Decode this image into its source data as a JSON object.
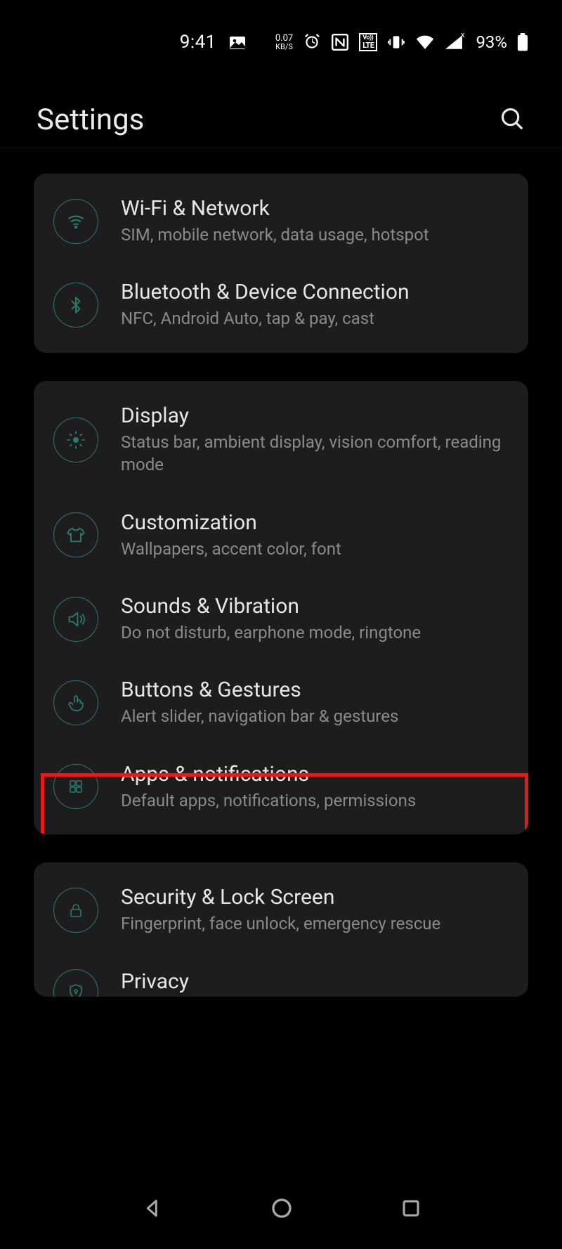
{
  "status": {
    "time": "9:41",
    "data_rate_value": "0.07",
    "data_rate_unit": "KB/S",
    "volte": "VoLTE",
    "battery_pct": "93%"
  },
  "header": {
    "title": "Settings"
  },
  "groups": [
    {
      "items": [
        {
          "icon": "wifi",
          "title": "Wi-Fi & Network",
          "sub": "SIM, mobile network, data usage, hotspot"
        },
        {
          "icon": "bluetooth",
          "title": "Bluetooth & Device Connection",
          "sub": "NFC, Android Auto, tap & pay, cast"
        }
      ]
    },
    {
      "items": [
        {
          "icon": "display",
          "title": "Display",
          "sub": "Status bar, ambient display, vision comfort, reading mode"
        },
        {
          "icon": "tshirt",
          "title": "Customization",
          "sub": "Wallpapers, accent color, font"
        },
        {
          "icon": "sound",
          "title": "Sounds & Vibration",
          "sub": "Do not disturb, earphone mode, ringtone"
        },
        {
          "icon": "gesture",
          "title": "Buttons & Gestures",
          "sub": "Alert slider, navigation bar & gestures"
        },
        {
          "icon": "apps",
          "title": "Apps & notifications",
          "sub": "Default apps, notifications, permissions",
          "highlight": true
        }
      ]
    },
    {
      "items": [
        {
          "icon": "lock",
          "title": "Security & Lock Screen",
          "sub": "Fingerprint, face unlock, emergency rescue"
        },
        {
          "icon": "privacy",
          "title": "Privacy",
          "sub": ""
        }
      ]
    }
  ],
  "accent": "#2b7a6f"
}
